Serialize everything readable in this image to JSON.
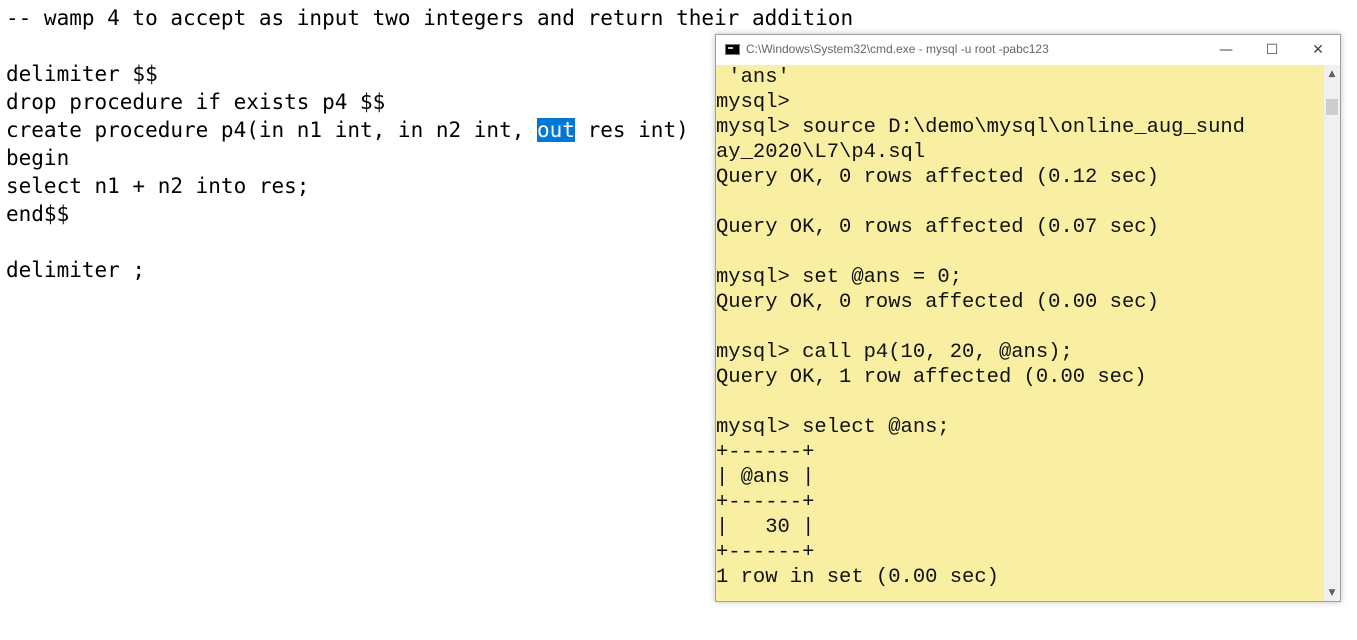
{
  "editor": {
    "lines": [
      "-- wamp 4 to accept as input two integers and return their addition",
      "",
      "delimiter $$",
      "drop procedure if exists p4 $$",
      "create procedure p4(in n1 int, in n2 int, ",
      "begin",
      "select n1 + n2 into res;",
      "end$$",
      "",
      "delimiter ;"
    ],
    "selected_text": "out",
    "after_selection": " res int)"
  },
  "cmd_window": {
    "title": "C:\\Windows\\System32\\cmd.exe - mysql  -u root -pabc123",
    "buttons": {
      "minimize": "—",
      "maximize": "☐",
      "close": "✕"
    },
    "console_lines": [
      " 'ans'",
      "mysql>",
      "mysql> source D:\\demo\\mysql\\online_aug_sund",
      "ay_2020\\L7\\p4.sql",
      "Query OK, 0 rows affected (0.12 sec)",
      "",
      "Query OK, 0 rows affected (0.07 sec)",
      "",
      "mysql> set @ans = 0;",
      "Query OK, 0 rows affected (0.00 sec)",
      "",
      "mysql> call p4(10, 20, @ans);",
      "Query OK, 1 row affected (0.00 sec)",
      "",
      "mysql> select @ans;",
      "+------+",
      "| @ans |",
      "+------+",
      "|   30 |",
      "+------+",
      "1 row in set (0.00 sec)"
    ],
    "scroll_up": "▲",
    "scroll_down": "▼"
  },
  "colors": {
    "console_bg": "#f9efa2",
    "selection": "#0078d7"
  }
}
